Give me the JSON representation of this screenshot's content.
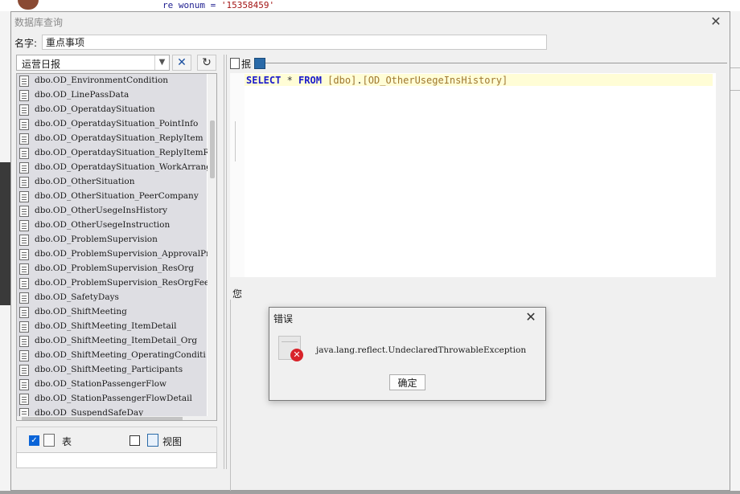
{
  "background": {
    "code_prefix": "re wonum = ",
    "code_literal": "'15358459'"
  },
  "dialog": {
    "title": "数据库查询",
    "close_glyph": "✕",
    "name_label": "名字:",
    "name_value": "重点事项",
    "category_selected": "运营日报",
    "tables": [
      "dbo.OD_EnvironmentCondition",
      "dbo.OD_LinePassData",
      "dbo.OD_OperatdaySituation",
      "dbo.OD_OperatdaySituation_PointInfo",
      "dbo.OD_OperatdaySituation_ReplyItem",
      "dbo.OD_OperatdaySituation_ReplyItemR",
      "dbo.OD_OperatdaySituation_WorkArrang",
      "dbo.OD_OtherSituation",
      "dbo.OD_OtherSituation_PeerCompany",
      "dbo.OD_OtherUsegeInsHistory",
      "dbo.OD_OtherUsegeInstruction",
      "dbo.OD_ProblemSupervision",
      "dbo.OD_ProblemSupervision_ApprovalPr",
      "dbo.OD_ProblemSupervision_ResOrg",
      "dbo.OD_ProblemSupervision_ResOrgFeed",
      "dbo.OD_SafetyDays",
      "dbo.OD_ShiftMeeting",
      "dbo.OD_ShiftMeeting_ItemDetail",
      "dbo.OD_ShiftMeeting_ItemDetail_Org",
      "dbo.OD_ShiftMeeting_OperatingConditi",
      "dbo.OD_ShiftMeeting_Participants",
      "dbo.OD_StationPassengerFlow",
      "dbo.OD_StationPassengerFlowDetail",
      "dbo.OD_SuspendSafeDay"
    ],
    "filter": {
      "table_label": "表",
      "table_checked": true,
      "view_label": "视图",
      "view_checked": false
    },
    "editor": {
      "pane_label": "抿",
      "sql_keyword_select": "SELECT",
      "sql_star": " * ",
      "sql_keyword_from": "FROM",
      "sql_schema": " [dbo]",
      "sql_dot": ".",
      "sql_table": "[OD_OtherUsegeInsHistory]",
      "status_fragment": "您"
    }
  },
  "error_dialog": {
    "title": "错误",
    "close_glyph": "✕",
    "message": "java.lang.reflect.UndeclaredThrowableException",
    "ok_label": "确定"
  }
}
